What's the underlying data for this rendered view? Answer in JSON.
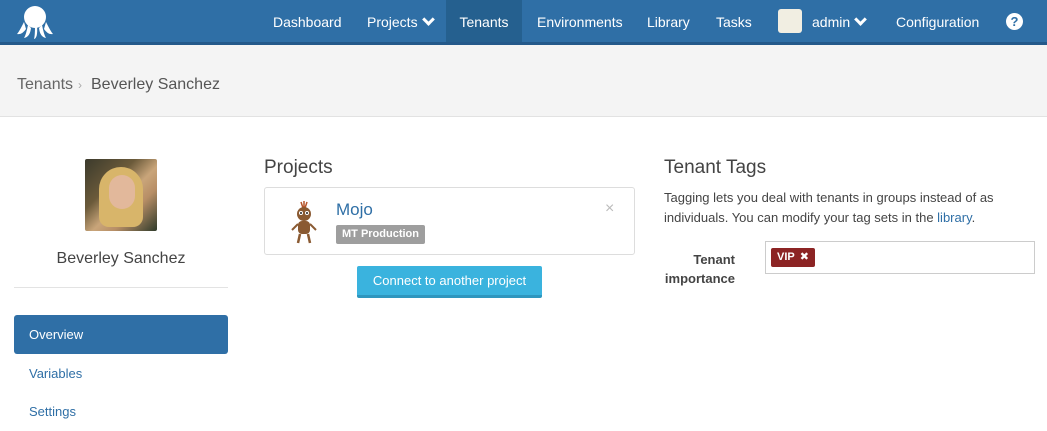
{
  "nav": {
    "logo_icon": "octopus-logo-icon",
    "items": [
      {
        "label": "Dashboard"
      },
      {
        "label": "Projects"
      },
      {
        "label": "Tenants"
      },
      {
        "label": "Environments"
      },
      {
        "label": "Library"
      },
      {
        "label": "Tasks"
      },
      {
        "label": "admin"
      },
      {
        "label": "Configuration"
      }
    ],
    "active": "Tenants",
    "help_label": "?"
  },
  "breadcrumb": {
    "parent": "Tenants",
    "separator": "›",
    "current": "Beverley Sanchez"
  },
  "tenant": {
    "name": "Beverley Sanchez"
  },
  "sidebar": {
    "items": [
      {
        "label": "Overview"
      },
      {
        "label": "Variables"
      },
      {
        "label": "Settings"
      }
    ],
    "active": "Overview"
  },
  "projects": {
    "heading": "Projects",
    "cards": [
      {
        "name": "Mojo",
        "environment": "MT Production",
        "remove_label": "×"
      }
    ],
    "connect_button": "Connect to another project"
  },
  "tags": {
    "heading": "Tenant Tags",
    "description_prefix": "Tagging lets you deal with tenants in groups instead of as individuals. You can modify your tag sets in the ",
    "description_link": "library",
    "description_suffix": ".",
    "fields": [
      {
        "label": "Tenant importance",
        "values": [
          {
            "label": "VIP",
            "remove_label": "✖"
          }
        ]
      }
    ]
  },
  "colors": {
    "nav_bg": "#2f6fa6",
    "accent": "#2f6fa6",
    "button": "#3ab3de",
    "tag_chip": "#8c2424",
    "env_badge": "#9e9e9e"
  }
}
